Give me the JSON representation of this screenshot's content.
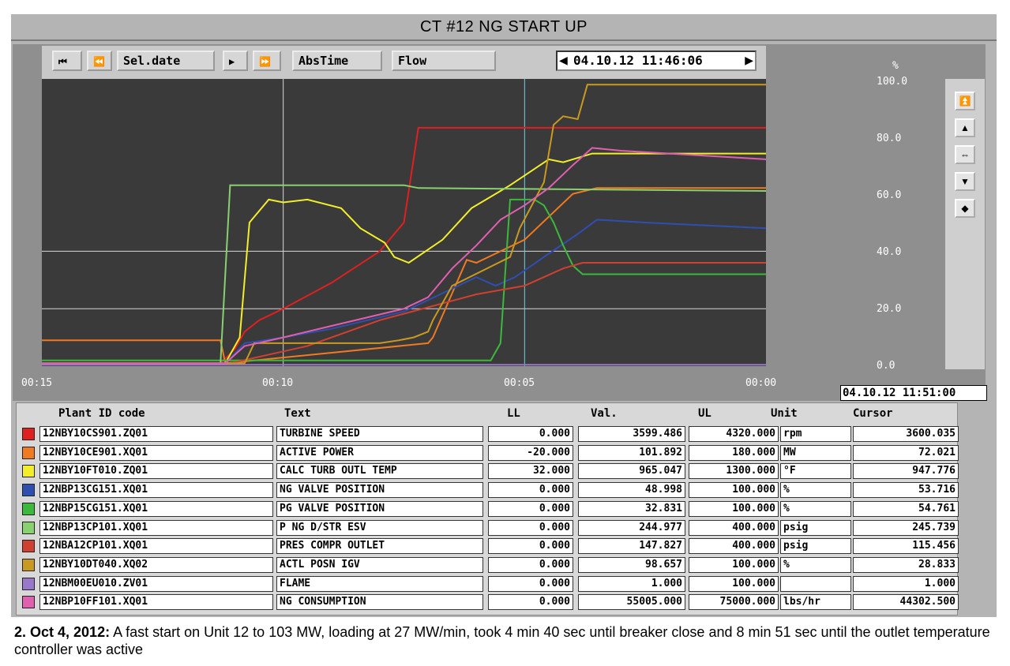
{
  "window": {
    "title": "CT #12 NG START UP"
  },
  "toolbar": {
    "sel_date": "Sel.date",
    "abs_time": "AbsTime",
    "flow": "Flow",
    "timestamp": "04.10.12 11:46:06"
  },
  "y_axis": {
    "unit": "%",
    "ticks": [
      "100.0",
      "80.0",
      "60.0",
      "40.0",
      "20.0",
      "0.0"
    ]
  },
  "x_axis": {
    "ticks": [
      "00:15",
      "00:10",
      "00:05",
      "00:00"
    ]
  },
  "cursor_stamp": "04.10.12 11:51:00",
  "table": {
    "headers": {
      "plant_id": "Plant ID code",
      "text": "Text",
      "ll": "LL",
      "val": "Val.",
      "ul": "UL",
      "unit": "Unit",
      "cursor": "Cursor"
    },
    "rows": [
      {
        "color": "#e02020",
        "id": "12NBY10CS901.ZQ01",
        "text": "TURBINE SPEED",
        "ll": "0.000",
        "val": "3599.486",
        "ul": "4320.000",
        "unit": "rpm",
        "cursor": "3600.035"
      },
      {
        "color": "#f07a20",
        "id": "12NBY10CE901.XQ01",
        "text": "ACTIVE POWER",
        "ll": "-20.000",
        "val": "101.892",
        "ul": "180.000",
        "unit": "MW",
        "cursor": "72.021"
      },
      {
        "color": "#f2ee2a",
        "id": "12NBY10FT010.ZQ01",
        "text": "CALC TURB OUTL TEMP",
        "ll": "32.000",
        "val": "965.047",
        "ul": "1300.000",
        "unit": "°F",
        "cursor": "947.776"
      },
      {
        "color": "#2f4fb0",
        "id": "12NBP13CG151.XQ01",
        "text": "NG VALVE POSITION",
        "ll": "0.000",
        "val": "48.998",
        "ul": "100.000",
        "unit": "%",
        "cursor": "53.716"
      },
      {
        "color": "#3cb83c",
        "id": "12NBP15CG151.XQ01",
        "text": "PG VALVE POSITION",
        "ll": "0.000",
        "val": "32.831",
        "ul": "100.000",
        "unit": "%",
        "cursor": "54.761"
      },
      {
        "color": "#88d070",
        "id": "12NBP13CP101.XQ01",
        "text": "P NG D/STR ESV",
        "ll": "0.000",
        "val": "244.977",
        "ul": "400.000",
        "unit": "psig",
        "cursor": "245.739"
      },
      {
        "color": "#d04030",
        "id": "12NBA12CP101.XQ01",
        "text": "PRES COMPR OUTLET",
        "ll": "0.000",
        "val": "147.827",
        "ul": "400.000",
        "unit": "psig",
        "cursor": "115.456"
      },
      {
        "color": "#c89a20",
        "id": "12NBY10DT040.XQ02",
        "text": "ACTL POSN IGV",
        "ll": "0.000",
        "val": "98.657",
        "ul": "100.000",
        "unit": "%",
        "cursor": "28.833"
      },
      {
        "color": "#9878c8",
        "id": "12NBM00EU010.ZV01",
        "text": "FLAME",
        "ll": "0.000",
        "val": "1.000",
        "ul": "100.000",
        "unit": "",
        "cursor": "1.000"
      },
      {
        "color": "#e060b0",
        "id": "12NBP10FF101.XQ01",
        "text": "NG CONSUMPTION",
        "ll": "0.000",
        "val": "55005.000",
        "ul": "75000.000",
        "unit": "lbs/hr",
        "cursor": "44302.500"
      }
    ]
  },
  "chart_data": {
    "type": "line",
    "xlabel": "",
    "ylabel": "",
    "x_ticks": [
      "00:15",
      "00:10",
      "00:05",
      "00:00"
    ],
    "xlim": [
      15,
      0
    ],
    "ylim": [
      0,
      100
    ],
    "y_unit": "%",
    "grid": true,
    "series": [
      {
        "name": "TURBINE SPEED",
        "color": "#e02020",
        "x": [
          15,
          11.3,
          11.0,
          10.8,
          10.5,
          10.0,
          9.0,
          8.0,
          7.5,
          7.2,
          5.0,
          0
        ],
        "y": [
          1,
          1,
          6,
          12,
          16,
          20,
          29,
          40,
          50,
          83,
          83,
          83
        ]
      },
      {
        "name": "ACTIVE POWER",
        "color": "#f07a20",
        "x": [
          15,
          11.3,
          11.2,
          7.0,
          6.9,
          6.2,
          6.0,
          5.0,
          4.0,
          3.5,
          0
        ],
        "y": [
          9,
          9,
          1,
          8,
          10,
          37,
          36,
          44,
          60,
          62,
          62
        ]
      },
      {
        "name": "CALC TURB OUTL TEMP",
        "color": "#f2ee2a",
        "x": [
          15,
          11.2,
          10.9,
          10.7,
          10.3,
          10.0,
          9.5,
          8.8,
          8.4,
          7.9,
          7.7,
          7.4,
          6.7,
          6.1,
          5.3,
          4.5,
          4.2,
          3.6,
          2.0,
          0
        ],
        "y": [
          1,
          1,
          10,
          50,
          58,
          57,
          58,
          55,
          48,
          43,
          38,
          36,
          44,
          55,
          63,
          72,
          71,
          74,
          74,
          74
        ]
      },
      {
        "name": "NG VALVE POSITION",
        "color": "#2f4fb0",
        "x": [
          15,
          11.2,
          10.8,
          10.0,
          9.0,
          7.5,
          6.0,
          5.6,
          5.2,
          4.6,
          3.9,
          3.5,
          2.5,
          0
        ],
        "y": [
          1,
          1,
          8,
          10,
          13,
          19,
          31,
          28,
          31,
          38,
          46,
          51,
          50,
          48
        ]
      },
      {
        "name": "PG VALVE POSITION",
        "color": "#3cb83c",
        "x": [
          15,
          5.7,
          5.5,
          5.3,
          4.8,
          4.6,
          4.4,
          4.2,
          4.0,
          3.8,
          0
        ],
        "y": [
          2,
          2,
          8,
          58,
          58,
          56,
          50,
          42,
          35,
          32,
          32
        ]
      },
      {
        "name": "P NG D/STR ESV",
        "color": "#88d070",
        "x": [
          15,
          11.3,
          11.1,
          7.5,
          7.2,
          0
        ],
        "y": [
          1,
          1,
          63,
          63,
          62,
          61
        ]
      },
      {
        "name": "PRES COMPR OUTLET",
        "color": "#d04030",
        "x": [
          15,
          11.3,
          11.1,
          9.5,
          8.0,
          6.0,
          5.0,
          4.2,
          3.8,
          0
        ],
        "y": [
          1,
          1,
          1,
          7,
          16,
          25,
          28,
          34,
          36,
          36
        ]
      },
      {
        "name": "ACTL POSN IGV",
        "color": "#c89a20",
        "x": [
          15,
          10.8,
          10.6,
          8.0,
          7.6,
          7.3,
          7.0,
          6.9,
          6.5,
          5.3,
          5.1,
          4.6,
          4.4,
          4.2,
          3.9,
          3.7,
          0
        ],
        "y": [
          1,
          1,
          8,
          8,
          9,
          10,
          12,
          16,
          28,
          38,
          48,
          64,
          84,
          87,
          86,
          98,
          98
        ]
      },
      {
        "name": "FLAME",
        "color": "#9878c8",
        "x": [
          15,
          0
        ],
        "y": [
          0.5,
          0.5
        ]
      },
      {
        "name": "NG CONSUMPTION",
        "color": "#e060b0",
        "x": [
          15,
          11.2,
          10.8,
          10.0,
          9.0,
          8.0,
          7.5,
          7.0,
          6.5,
          6.0,
          5.5,
          5.0,
          4.5,
          4.0,
          3.6,
          3.0,
          2.0,
          1.0,
          0
        ],
        "y": [
          1,
          1,
          7,
          10,
          14,
          18,
          20,
          24,
          34,
          42,
          51,
          56,
          62,
          70,
          76,
          75,
          74,
          73,
          72
        ]
      }
    ]
  },
  "caption": {
    "lead": "2. Oct 4, 2012:",
    "body": " A fast start on Unit 12 to 103 MW, loading at 27 MW/min, took 4 min 40 sec until breaker close and 8 min 51 sec until the outlet temperature controller was active"
  }
}
